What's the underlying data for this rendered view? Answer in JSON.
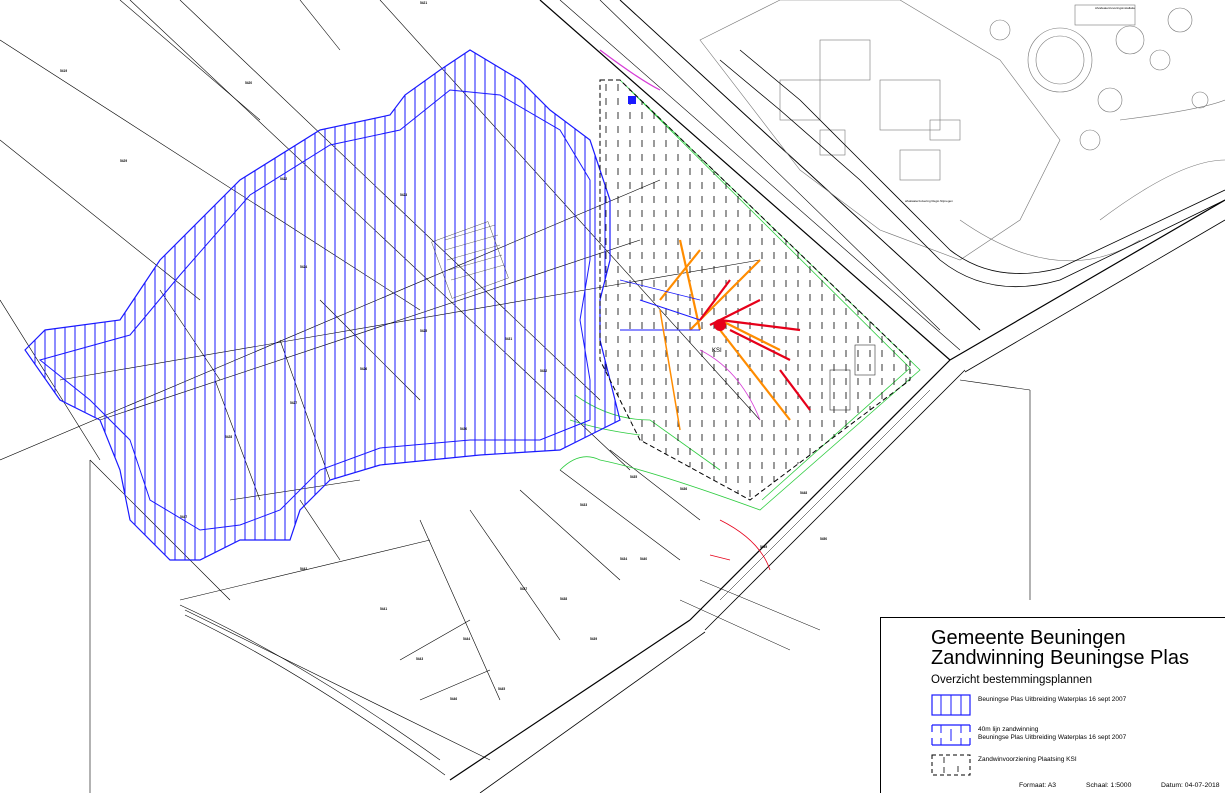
{
  "map": {
    "plot_numbers": [
      "5419",
      "5420",
      "5421",
      "5422",
      "5423",
      "5424",
      "5425",
      "5426",
      "5427",
      "5428",
      "5429",
      "5430",
      "5431",
      "5432",
      "5433",
      "5434",
      "5435",
      "5436",
      "5437",
      "5438",
      "5439",
      "5440",
      "5441",
      "5442",
      "5443",
      "5444",
      "5445",
      "5446",
      "5447",
      "5448",
      "5449",
      "5450"
    ],
    "small_labels": [
      "Afvalwaterzuiveringsinstallatie",
      "afvalwaterzuivering Regio Nijmegen",
      "KSI"
    ]
  },
  "legend": {
    "title_line1": "Gemeente Beuningen",
    "title_line2": "Zandwinning Beuningse Plas",
    "subtitle": "Overzicht bestemmingsplannen",
    "items": [
      {
        "label": "Beuningse Plas Uitbreiding Waterplas 16 sept 2007"
      },
      {
        "label": "40m lijn zandwinning\nBeuningse Plas Uitbreiding Waterplas 16 sept 2007"
      },
      {
        "label": "Zandwinvoorziening Plaatsing KSI"
      }
    ],
    "footer": {
      "format": "Formaat: A3",
      "scale": "Schaal: 1:5000",
      "date": "Datum: 04-07-2018"
    }
  },
  "colors": {
    "waterplas": "#1a1aff",
    "ksi_outline": "#000000",
    "green_zone": "#2ecc40",
    "orange": "#ff8c00",
    "red": "#e6001a",
    "magenta": "#d63ad6"
  }
}
